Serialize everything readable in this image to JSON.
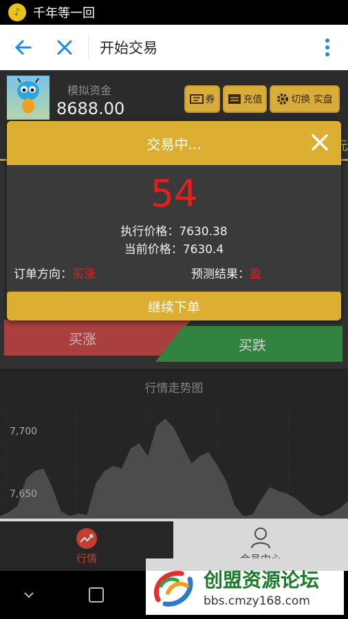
{
  "status_bar": {
    "app_name": "千年等一回"
  },
  "nav": {
    "title": "开始交易"
  },
  "header": {
    "fund_label": "模拟资金",
    "fund_value": "8688.00",
    "btn_voucher": "券",
    "btn_recharge": "充值",
    "btn_switch": "切换 实盘"
  },
  "tab_strip": {
    "edge_text": "元"
  },
  "trade": {
    "buy_up": "买涨",
    "buy_down": "买跌"
  },
  "chart": {
    "title": "行情走势图",
    "tick_labels": [
      "7,700",
      "7,650"
    ]
  },
  "chart_data": {
    "type": "area",
    "title": "行情走势图",
    "xlabel": "",
    "ylabel": "",
    "ylim": [
      7630,
      7720
    ],
    "y_ticks": [
      7700,
      7650
    ],
    "values": [
      7632,
      7635,
      7640,
      7662,
      7668,
      7670,
      7655,
      7636,
      7632,
      7634,
      7633,
      7658,
      7668,
      7672,
      7670,
      7686,
      7690,
      7680,
      7704,
      7710,
      7702,
      7688,
      7674,
      7680,
      7683,
      7672,
      7660,
      7640,
      7632,
      7633,
      7645,
      7655,
      7652,
      7650,
      7646,
      7640,
      7634,
      7632,
      7634,
      7638,
      7644
    ],
    "color": "#5a5a5a",
    "grid": true
  },
  "bottom_nav": {
    "market_label": "行情",
    "member_label": "会员中心"
  },
  "watermark": {
    "title": "创盟资源论坛",
    "url": "bbs.cmzy168.com"
  },
  "dialog": {
    "title": "交易中...",
    "countdown": "54",
    "exec_price_label": "执行价格：",
    "exec_price": "7630.38",
    "current_price_label": "当前价格：",
    "current_price": "7630.4",
    "direction_label": "订单方向：",
    "direction_value": "买涨",
    "result_label": "预测结果：",
    "result_value": "盈",
    "continue_label": "继续下单"
  },
  "colors": {
    "accent": "#dcae32",
    "up": "#c84a4a",
    "down": "#3a9a4a",
    "alert": "#e32020"
  }
}
